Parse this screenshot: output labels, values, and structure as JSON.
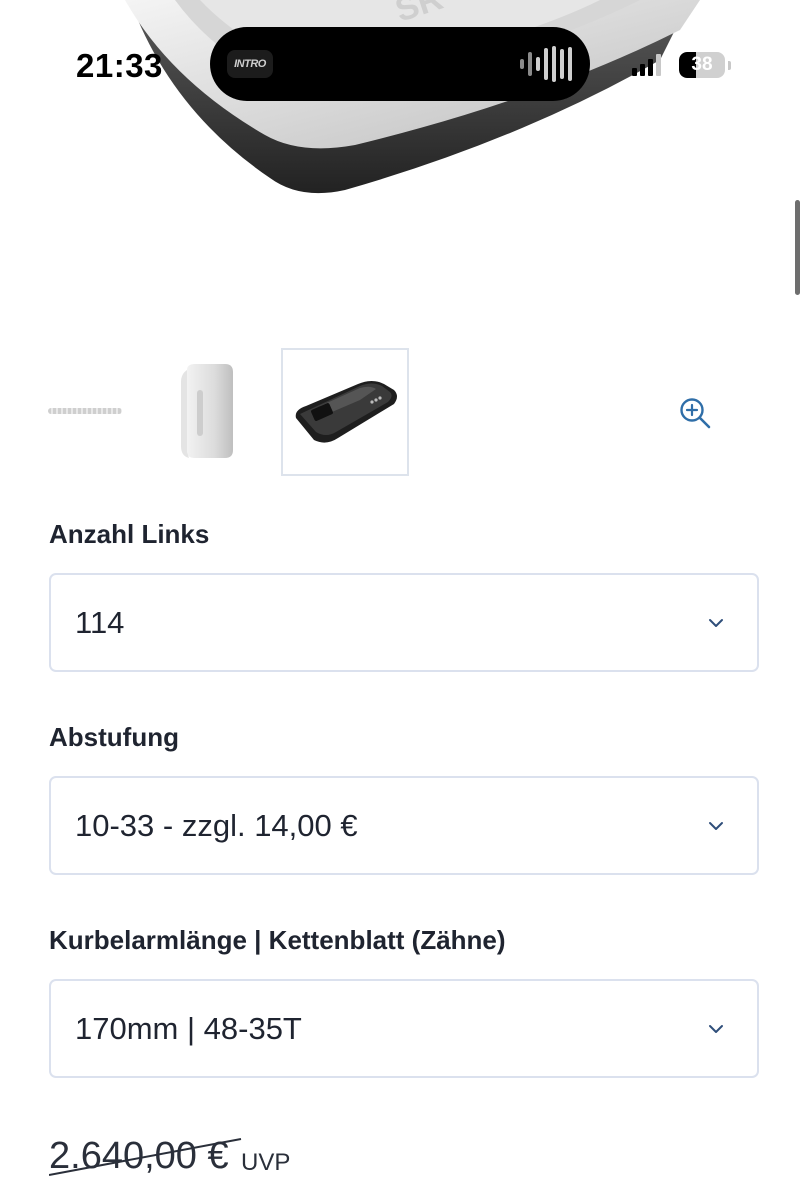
{
  "status_bar": {
    "time": "21:33",
    "island_art_text": "INTRO",
    "battery": "38",
    "battery_level": 0.38,
    "signal_icon": "cellular-signal-icon"
  },
  "gallery": {
    "hero_icon": "charger-dock-product-image",
    "thumbnails": [
      {
        "icon": "product-image-partial"
      },
      {
        "icon": "battery-pack-image"
      },
      {
        "icon": "charger-dock-image",
        "selected": true
      }
    ],
    "zoom_icon": "zoom-in-icon"
  },
  "options": [
    {
      "label": "Anzahl Links",
      "value": "114"
    },
    {
      "label": "Abstufung",
      "value": "10-33 - zzgl. 14,00 €"
    },
    {
      "label": "Kurbelarmlänge | Kettenblatt (Zähne)",
      "value": "170mm | 48-35T"
    }
  ],
  "price": {
    "old": "2.640,00 €",
    "old_suffix": "UVP"
  },
  "colors": {
    "accent": "#2f6ea8",
    "text": "#1f2430",
    "border": "#dbe1ee"
  }
}
